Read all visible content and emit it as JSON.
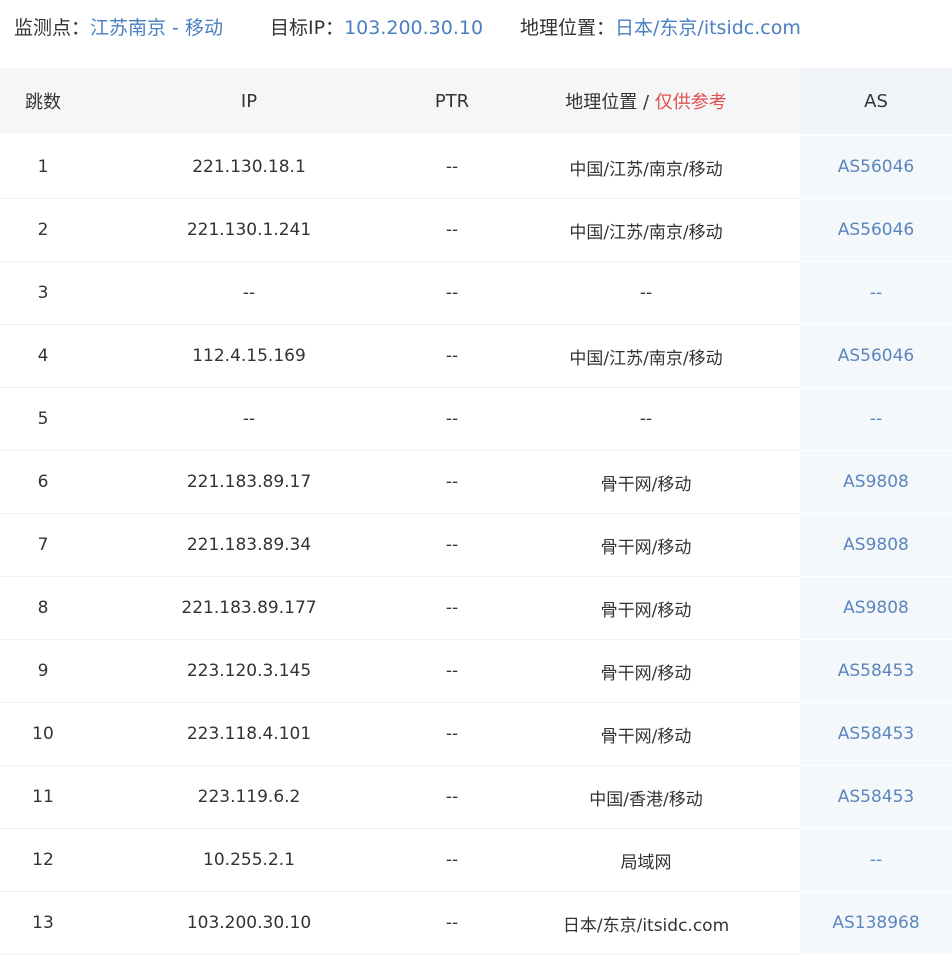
{
  "header": {
    "monitor_label": "监测点：",
    "monitor_value": "江苏南京 - 移动",
    "target_label": "目标IP：",
    "target_value": "103.200.30.10",
    "geo_label": "地理位置：",
    "geo_value": "日本/东京/itsidc.com"
  },
  "table": {
    "columns": {
      "hop": "跳数",
      "ip": "IP",
      "ptr": "PTR",
      "geo": "地理位置",
      "geo_sep": " / ",
      "geo_note": "仅供参考",
      "as": "AS"
    },
    "rows": [
      {
        "hop": "1",
        "ip": "221.130.18.1",
        "ptr": "--",
        "geo": "中国/江苏/南京/移动",
        "as": "AS56046"
      },
      {
        "hop": "2",
        "ip": "221.130.1.241",
        "ptr": "--",
        "geo": "中国/江苏/南京/移动",
        "as": "AS56046"
      },
      {
        "hop": "3",
        "ip": "--",
        "ptr": "--",
        "geo": "--",
        "as": "--"
      },
      {
        "hop": "4",
        "ip": "112.4.15.169",
        "ptr": "--",
        "geo": "中国/江苏/南京/移动",
        "as": "AS56046"
      },
      {
        "hop": "5",
        "ip": "--",
        "ptr": "--",
        "geo": "--",
        "as": "--"
      },
      {
        "hop": "6",
        "ip": "221.183.89.17",
        "ptr": "--",
        "geo": "骨干网/移动",
        "as": "AS9808"
      },
      {
        "hop": "7",
        "ip": "221.183.89.34",
        "ptr": "--",
        "geo": "骨干网/移动",
        "as": "AS9808"
      },
      {
        "hop": "8",
        "ip": "221.183.89.177",
        "ptr": "--",
        "geo": "骨干网/移动",
        "as": "AS9808"
      },
      {
        "hop": "9",
        "ip": "223.120.3.145",
        "ptr": "--",
        "geo": "骨干网/移动",
        "as": "AS58453"
      },
      {
        "hop": "10",
        "ip": "223.118.4.101",
        "ptr": "--",
        "geo": "骨干网/移动",
        "as": "AS58453"
      },
      {
        "hop": "11",
        "ip": "223.119.6.2",
        "ptr": "--",
        "geo": "中国/香港/移动",
        "as": "AS58453"
      },
      {
        "hop": "12",
        "ip": "10.255.2.1",
        "ptr": "--",
        "geo": "局域网",
        "as": "--"
      },
      {
        "hop": "13",
        "ip": "103.200.30.10",
        "ptr": "--",
        "geo": "日本/东京/itsidc.com",
        "as": "AS138968"
      }
    ]
  },
  "colors": {
    "link": "#4a7fc1",
    "note_red": "#e05252",
    "header_bg": "#f5f6f8"
  }
}
